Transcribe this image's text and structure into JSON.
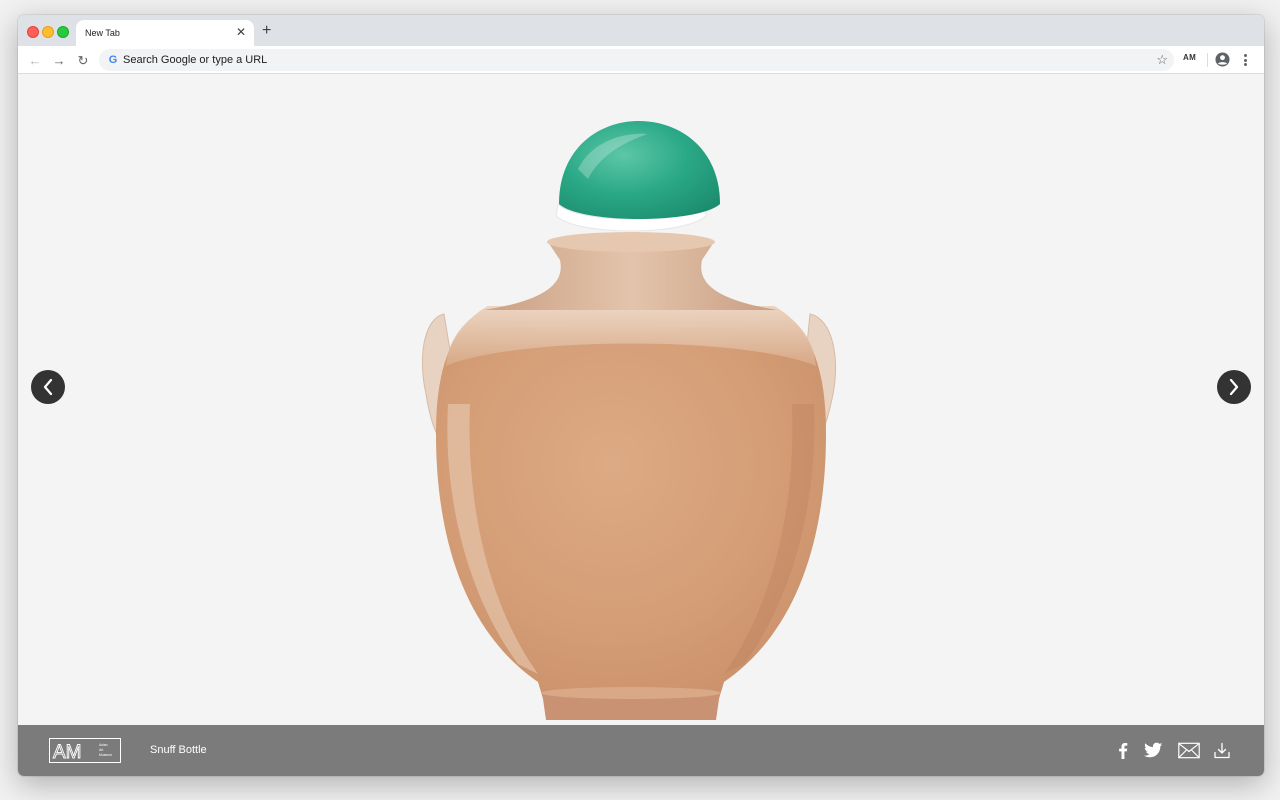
{
  "browser": {
    "tab": {
      "title": "New Tab",
      "close_glyph": "✕"
    },
    "new_tab_glyph": "+",
    "toolbar": {
      "back_glyph": "←",
      "forward_glyph": "→",
      "reload_glyph": "↻",
      "omnibox_placeholder": "Search Google or type a URL",
      "google_glyph": "G",
      "star_glyph": "☆",
      "extension_label": "AM"
    }
  },
  "viewer": {
    "artwork_title": "Snuff Bottle",
    "logo_text": "AM",
    "logo_subtext": [
      "Asian",
      "Art",
      "Museum"
    ]
  },
  "colors": {
    "footer_bg": "#7b7b7b",
    "arrow_bg": "#333333",
    "bottle_body": "#d9a47e",
    "stopper": "#2aa886"
  },
  "icons": {
    "prev": "chevron-left-icon",
    "next": "chevron-right-icon",
    "facebook": "facebook-icon",
    "twitter": "twitter-icon",
    "mail": "mail-icon",
    "download": "download-icon"
  }
}
